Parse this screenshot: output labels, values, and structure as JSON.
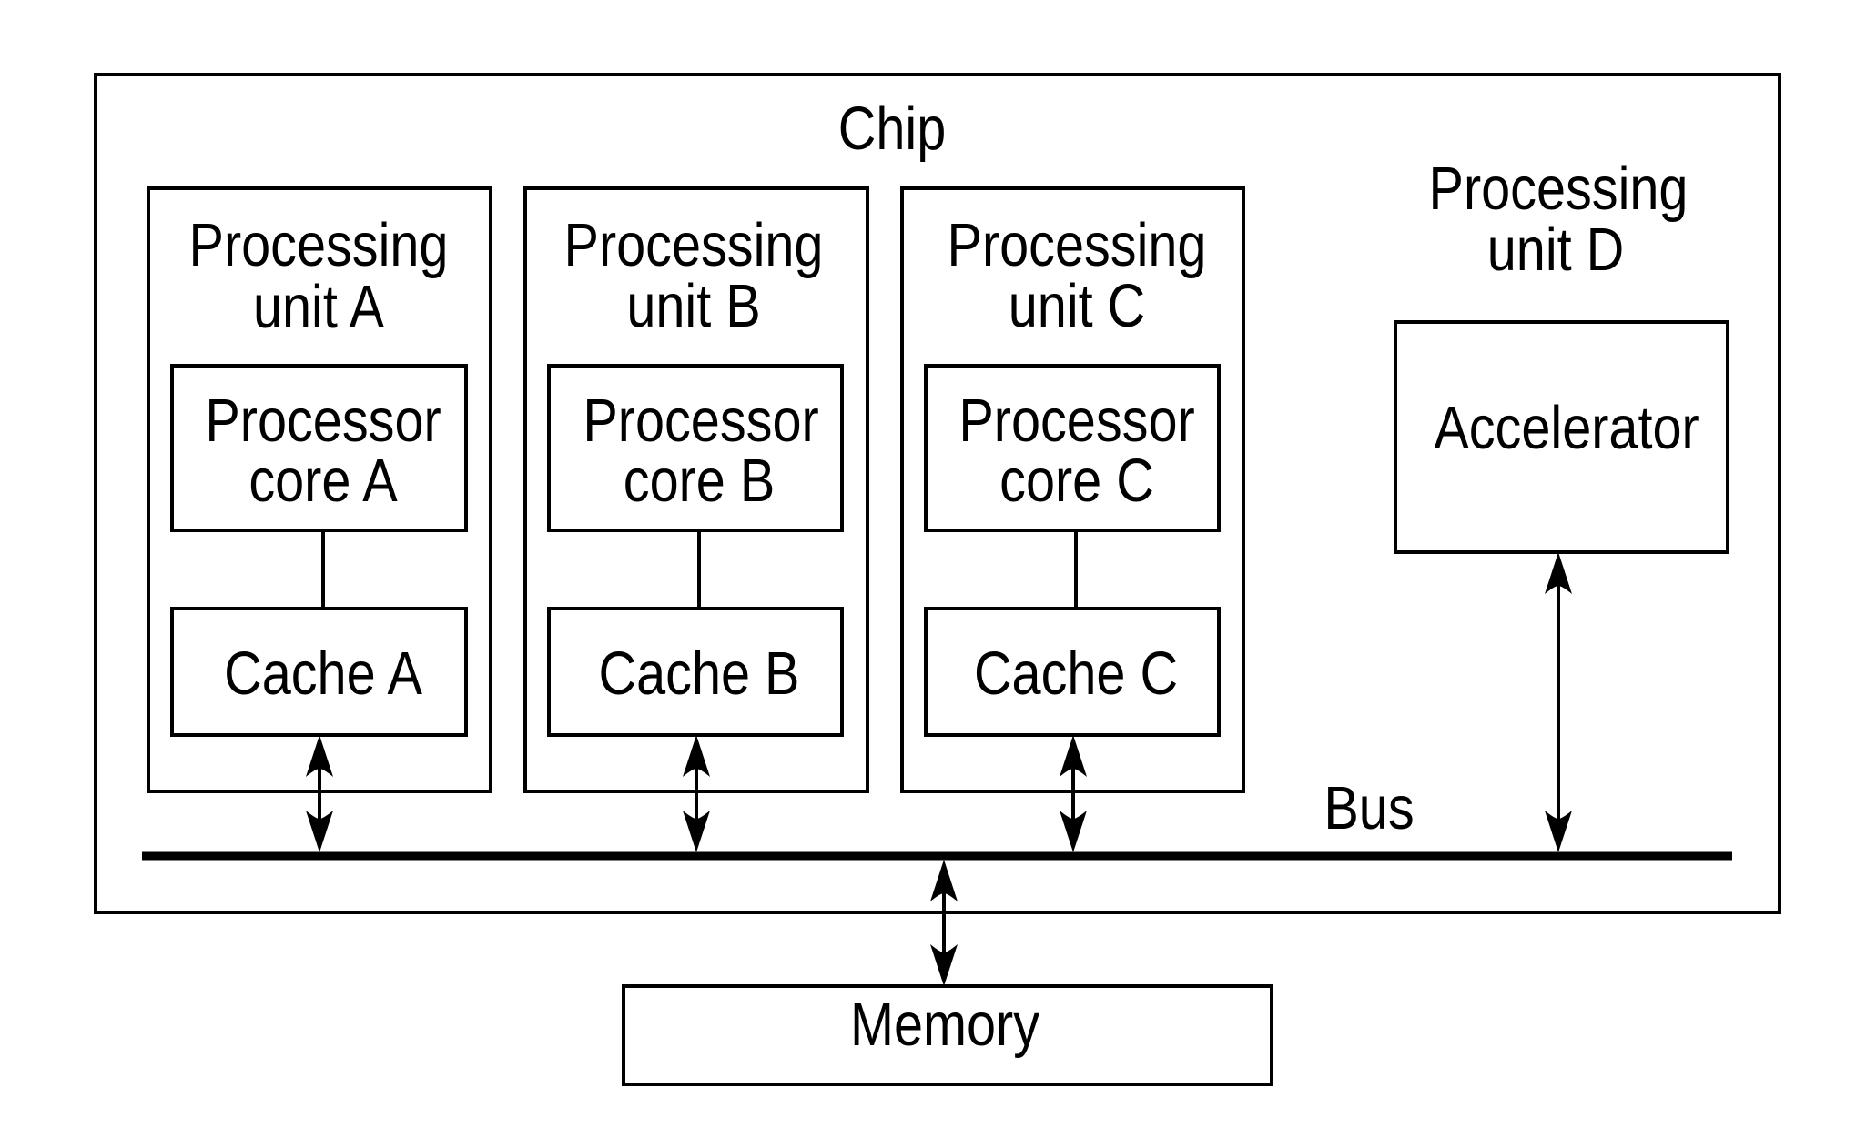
{
  "diagram": {
    "chip": {
      "label": "Chip"
    },
    "processing_units": [
      {
        "id": "A",
        "label_line1": "Processing",
        "label_line2": "unit A",
        "core": {
          "line1": "Processor",
          "line2": "core A"
        },
        "cache": {
          "label": "Cache A"
        }
      },
      {
        "id": "B",
        "label_line1": "Processing",
        "label_line2": "unit B",
        "core": {
          "line1": "Processor",
          "line2": "core B"
        },
        "cache": {
          "label": "Cache B"
        }
      },
      {
        "id": "C",
        "label_line1": "Processing",
        "label_line2": "unit C",
        "core": {
          "line1": "Processor",
          "line2": "core C"
        },
        "cache": {
          "label": "Cache C"
        }
      }
    ],
    "processing_unit_d": {
      "label_line1": "Processing",
      "label_line2": "unit D",
      "accelerator": {
        "label": "Accelerator"
      }
    },
    "bus": {
      "label": "Bus"
    },
    "memory": {
      "label": "Memory"
    },
    "connections": [
      {
        "from": "Processor core A",
        "to": "Cache A",
        "type": "line"
      },
      {
        "from": "Processor core B",
        "to": "Cache B",
        "type": "line"
      },
      {
        "from": "Processor core C",
        "to": "Cache C",
        "type": "line"
      },
      {
        "from": "Cache A",
        "to": "Bus",
        "type": "bidirectional-arrow"
      },
      {
        "from": "Cache B",
        "to": "Bus",
        "type": "bidirectional-arrow"
      },
      {
        "from": "Cache C",
        "to": "Bus",
        "type": "bidirectional-arrow"
      },
      {
        "from": "Accelerator",
        "to": "Bus",
        "type": "bidirectional-arrow"
      },
      {
        "from": "Bus",
        "to": "Memory",
        "type": "bidirectional-arrow"
      }
    ]
  }
}
